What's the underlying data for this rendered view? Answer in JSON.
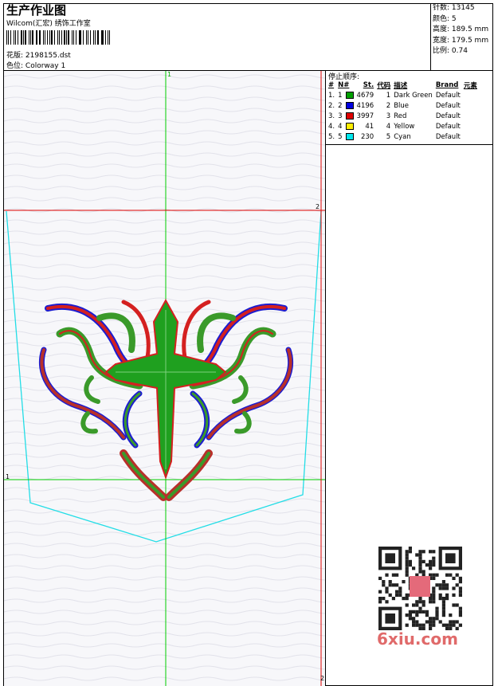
{
  "header": {
    "title": "生产作业图",
    "subtitle": "Wilcom(汇宏) 绣饰工作室",
    "design_label": "花版:",
    "design_value": "2198155.dst",
    "colorway_label": "色位:",
    "colorway_value": "Colorway 1"
  },
  "stats": {
    "stitches_label": "针数:",
    "stitches": "13145",
    "colors_label": "颜色:",
    "colors": "5",
    "height_label": "高度:",
    "height": "189.5 mm",
    "width_label": "宽度:",
    "width": "179.5 mm",
    "scale_label": "比例:",
    "scale": "0.74"
  },
  "guides": {
    "top_marker": "1",
    "right_marker": "2",
    "left_marker": "1",
    "bottom_marker": "2"
  },
  "color_panel": {
    "title": "停止顺序:",
    "headers": [
      "#",
      "N#",
      "St.",
      "代码",
      "描述",
      "Brand",
      "元素"
    ],
    "rows": [
      {
        "idx": "1.",
        "n": "1",
        "stitches": "4679",
        "code": "1",
        "desc": "Dark Green",
        "brand": "Default",
        "color": "#00a000"
      },
      {
        "idx": "2.",
        "n": "2",
        "stitches": "4196",
        "code": "2",
        "desc": "Blue",
        "brand": "Default",
        "color": "#0000e0"
      },
      {
        "idx": "3.",
        "n": "3",
        "stitches": "3997",
        "code": "3",
        "desc": "Red",
        "brand": "Default",
        "color": "#e00000"
      },
      {
        "idx": "4.",
        "n": "4",
        "stitches": "41",
        "code": "4",
        "desc": "Yellow",
        "brand": "Default",
        "color": "#ffee00"
      },
      {
        "idx": "5.",
        "n": "5",
        "stitches": "230",
        "code": "5",
        "desc": "Cyan",
        "brand": "Default",
        "color": "#00e8ee"
      }
    ]
  },
  "watermark": {
    "site": "6xiu.com"
  }
}
